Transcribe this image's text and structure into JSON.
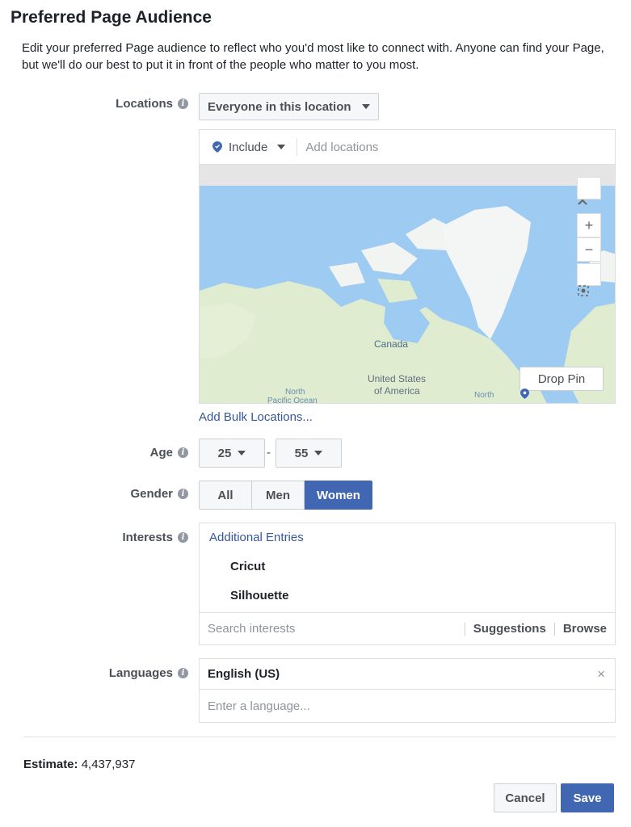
{
  "header": {
    "title": "Preferred Page Audience",
    "description": "Edit your preferred Page audience to reflect who you'd most like to connect with. Anyone can find your Page, but we'll do our best to put it in front of the people who matter to you most."
  },
  "locations": {
    "label": "Locations",
    "scope_selected": "Everyone in this location",
    "include_label": "Include",
    "input_placeholder": "Add locations",
    "map_labels": [
      "Canada",
      "United States",
      "of America",
      "North",
      "Pacific Ocean",
      "North"
    ],
    "drop_pin_label": "Drop Pin",
    "bulk_link": "Add Bulk Locations..."
  },
  "age": {
    "label": "Age",
    "min": "25",
    "separator": "-",
    "max": "55"
  },
  "gender": {
    "label": "Gender",
    "options": [
      "All",
      "Men",
      "Women"
    ],
    "selected": "Women"
  },
  "interests": {
    "label": "Interests",
    "heading": "Additional Entries",
    "items": [
      "Cricut",
      "Silhouette"
    ],
    "search_placeholder": "Search interests",
    "suggestions_label": "Suggestions",
    "browse_label": "Browse"
  },
  "languages": {
    "label": "Languages",
    "selected": "English (US)",
    "input_placeholder": "Enter a language..."
  },
  "estimate": {
    "label": "Estimate:",
    "value": "4,437,937"
  },
  "actions": {
    "cancel_label": "Cancel",
    "save_label": "Save"
  },
  "colors": {
    "brand": "#4267b2",
    "link": "#365899",
    "water": "#9ecbf2",
    "land": "#dfeccf",
    "ice": "#f4f6f6"
  }
}
